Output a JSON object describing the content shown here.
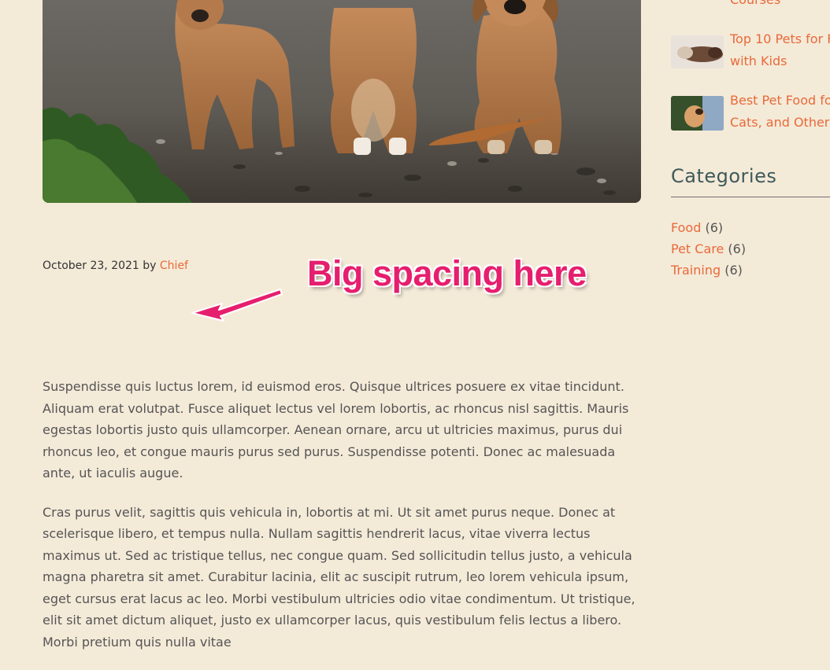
{
  "hero": {
    "alt_description": ""
  },
  "post_meta": {
    "date": "October 23, 2021",
    "by": "by",
    "author": "Chief"
  },
  "annotation": {
    "text": "Big spacing here"
  },
  "article": {
    "paragraphs": [
      "Suspendisse quis luctus lorem, id euismod eros. Quisque ultrices posuere ex vitae tincidunt. Aliquam erat volutpat. Fusce aliquet lectus vel lorem lobortis, ac rhoncus nisl sagittis. Mauris egestas lobortis justo quis ullamcorper. Aenean ornare, arcu ut ultricies maximus, purus dui rhoncus leo, et congue mauris purus sed purus. Suspendisse potenti. Donec ac malesuada ante, ut iaculis augue.",
      "Cras purus velit, sagittis quis vehicula in, lobortis at mi. Ut sit amet purus neque. Donec at scelerisque libero, et tempus nulla. Nullam sagittis hendrerit lacus, vitae viverra lectus maximus ut. Sed ac tristique tellus, nec congue quam. Sed sollicitudin tellus justo, a vehicula magna pharetra sit amet. Curabitur lacinia, elit ac suscipit rutrum, leo lorem vehicula ipsum, eget cursus erat lacus ac leo. Morbi vestibulum ultricies odio vitae condimentum. Ut tristique, elit sit amet dictum aliquet, justo ex ullamcorper lacus, quis vestibulum felis lectus a libero. Morbi pretium quis nulla vitae"
    ]
  },
  "sidebar": {
    "recent_posts": [
      {
        "line1": "Courses",
        "line2": ""
      },
      {
        "line1": "Top 10 Pets for F",
        "line2": "with Kids"
      },
      {
        "line1": "Best Pet Food fo",
        "line2": "Cats, and Other A"
      }
    ],
    "categories_title": "Categories",
    "categories": [
      {
        "name": "Food",
        "count": "(6)"
      },
      {
        "name": "Pet Care",
        "count": "(6)"
      },
      {
        "name": "Training",
        "count": "(6)"
      }
    ]
  },
  "colors": {
    "background": "#f4ead8",
    "accent": "#e86a3a",
    "annotation": "#e61e6e",
    "heading": "#3f5a5a"
  }
}
